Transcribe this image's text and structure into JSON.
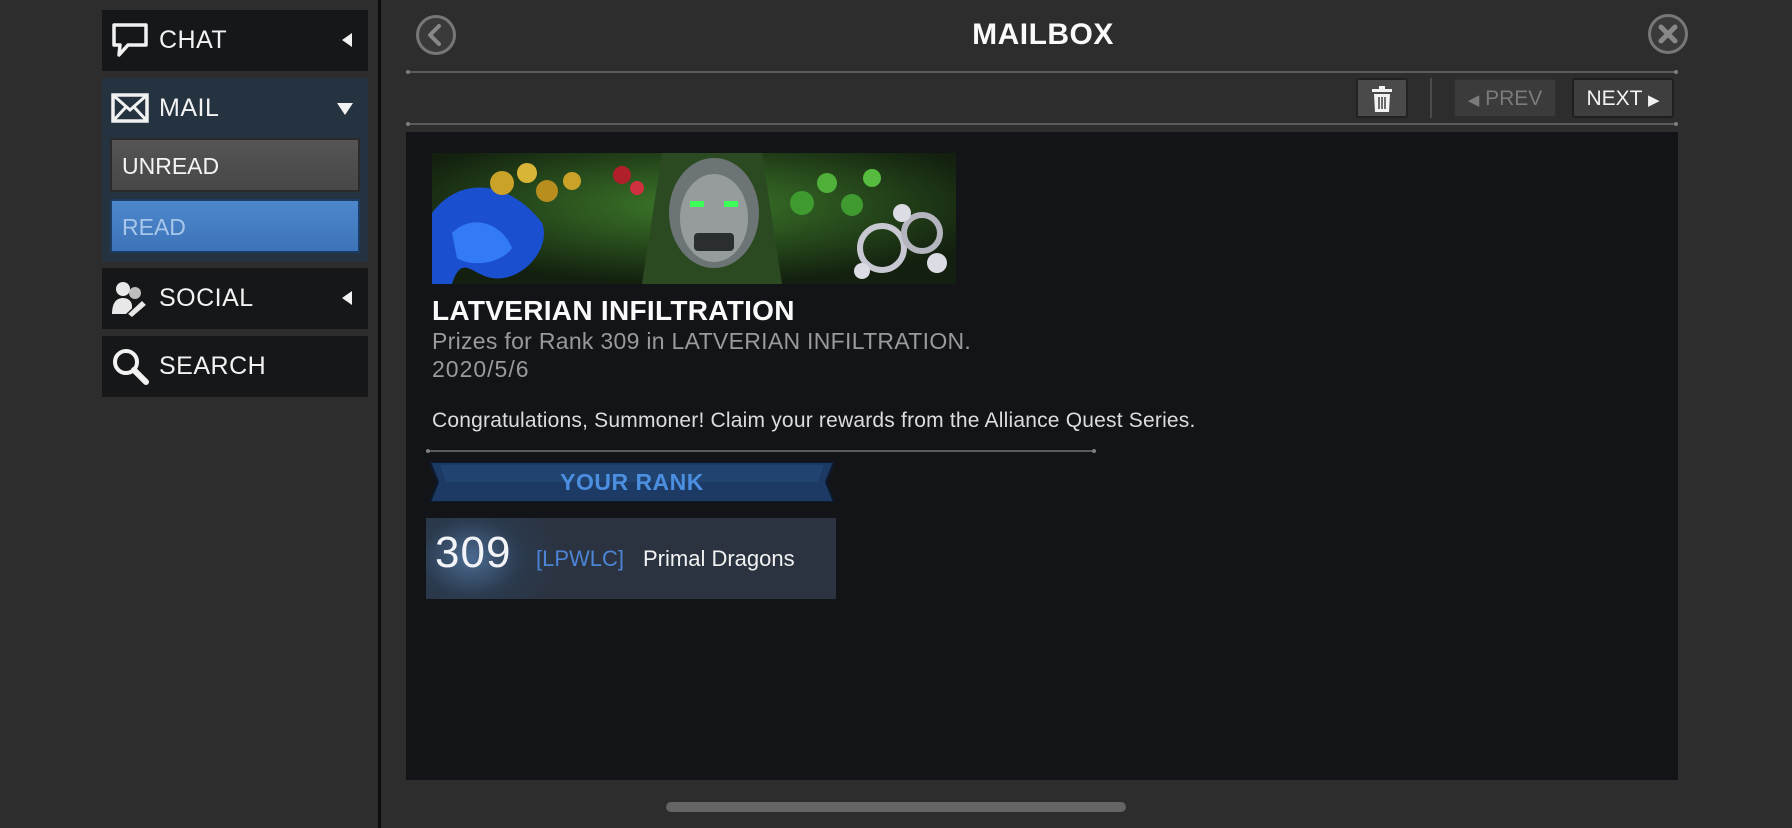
{
  "nav": {
    "chat": {
      "label": "CHAT",
      "icon": "chat-bubble-icon"
    },
    "mail": {
      "label": "MAIL",
      "icon": "envelope-icon",
      "unread_label": "UNREAD",
      "read_label": "READ"
    },
    "social": {
      "label": "SOCIAL",
      "icon": "friends-icon"
    },
    "search": {
      "label": "SEARCH",
      "icon": "magnifier-icon"
    }
  },
  "header": {
    "title": "MAILBOX",
    "prev_label": "PREV",
    "next_label": "NEXT"
  },
  "message": {
    "title": "LATVERIAN INFILTRATION",
    "subtitle": "Prizes for Rank 309 in LATVERIAN INFILTRATION.",
    "date": "2020/5/6",
    "body": "Congratulations, Summoner! Claim your rewards from the Alliance Quest Series.",
    "rank_heading": "YOUR RANK",
    "rank": "309",
    "alliance_tag": "[LPWLC]",
    "alliance_name": "Primal Dragons"
  },
  "colors": {
    "accent_blue": "#3d73b8",
    "rank_text": "#4c8ee0",
    "background": "#2d2d2e",
    "panel": "#121418"
  }
}
